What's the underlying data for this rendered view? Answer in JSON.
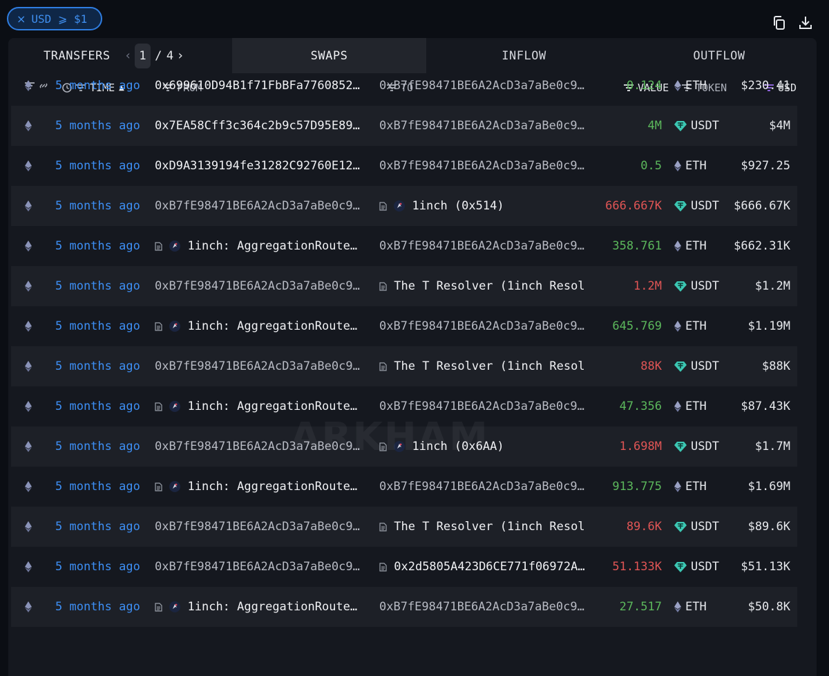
{
  "filter": {
    "close": "×",
    "label": "USD ⩾ $1"
  },
  "toolbar": {
    "copy_icon": "copy-icon",
    "download_icon": "download-icon"
  },
  "tabs": {
    "transfers": "TRANSFERS",
    "page": "1",
    "page_sep": "/",
    "page_total": "4",
    "swaps": "SWAPS",
    "inflow": "INFLOW",
    "outflow": "OUTFLOW"
  },
  "headers": {
    "time": "TIME",
    "from": "FROM",
    "to": "TO",
    "value": "VALUE",
    "token": "TOKEN",
    "usd": "USD"
  },
  "watermark": "ARKHAM",
  "rows": [
    {
      "time": "5 months ago",
      "from": "0x699610D94B1f71FbBFa7760852…",
      "from_entity": false,
      "to": "0xB7fE98471BE6A2AcD3a7aBe0c9…",
      "to_entity": false,
      "to_doc": false,
      "value": "0.124",
      "value_class": "pos",
      "token": "ETH",
      "usd": "$230.41"
    },
    {
      "time": "5 months ago",
      "from": "0x7EA58Cff3c364c2b9c57D95E89…",
      "from_entity": false,
      "to": "0xB7fE98471BE6A2AcD3a7aBe0c9…",
      "to_entity": false,
      "to_doc": false,
      "value": "4M",
      "value_class": "pos",
      "token": "USDT",
      "usd": "$4M"
    },
    {
      "time": "5 months ago",
      "from": "0xD9A3139194fe31282C92760E12…",
      "from_entity": false,
      "to": "0xB7fE98471BE6A2AcD3a7aBe0c9…",
      "to_entity": false,
      "to_doc": false,
      "value": "0.5",
      "value_class": "pos",
      "token": "ETH",
      "usd": "$927.25"
    },
    {
      "time": "5 months ago",
      "from": "0xB7fE98471BE6A2AcD3a7aBe0c9…",
      "from_entity": false,
      "to": "1inch (0x514)",
      "to_entity": true,
      "to_doc": true,
      "value": "666.667K",
      "value_class": "neg",
      "token": "USDT",
      "usd": "$666.67K"
    },
    {
      "time": "5 months ago",
      "from": "1inch: AggregationRoute…",
      "from_entity": true,
      "to": "0xB7fE98471BE6A2AcD3a7aBe0c9…",
      "to_entity": false,
      "to_doc": false,
      "value": "358.761",
      "value_class": "pos",
      "token": "ETH",
      "usd": "$662.31K"
    },
    {
      "time": "5 months ago",
      "from": "0xB7fE98471BE6A2AcD3a7aBe0c9…",
      "from_entity": false,
      "to": "The T Resolver (1inch Resol",
      "to_entity": false,
      "to_doc": true,
      "value": "1.2M",
      "value_class": "neg",
      "token": "USDT",
      "usd": "$1.2M"
    },
    {
      "time": "5 months ago",
      "from": "1inch: AggregationRoute…",
      "from_entity": true,
      "to": "0xB7fE98471BE6A2AcD3a7aBe0c9…",
      "to_entity": false,
      "to_doc": false,
      "value": "645.769",
      "value_class": "pos",
      "token": "ETH",
      "usd": "$1.19M"
    },
    {
      "time": "5 months ago",
      "from": "0xB7fE98471BE6A2AcD3a7aBe0c9…",
      "from_entity": false,
      "to": "The T Resolver (1inch Resol",
      "to_entity": false,
      "to_doc": true,
      "value": "88K",
      "value_class": "neg",
      "token": "USDT",
      "usd": "$88K"
    },
    {
      "time": "5 months ago",
      "from": "1inch: AggregationRoute…",
      "from_entity": true,
      "to": "0xB7fE98471BE6A2AcD3a7aBe0c9…",
      "to_entity": false,
      "to_doc": false,
      "value": "47.356",
      "value_class": "pos",
      "token": "ETH",
      "usd": "$87.43K"
    },
    {
      "time": "5 months ago",
      "from": "0xB7fE98471BE6A2AcD3a7aBe0c9…",
      "from_entity": false,
      "to": "1inch (0x6AA)",
      "to_entity": true,
      "to_doc": true,
      "value": "1.698M",
      "value_class": "neg",
      "token": "USDT",
      "usd": "$1.7M"
    },
    {
      "time": "5 months ago",
      "from": "1inch: AggregationRoute…",
      "from_entity": true,
      "to": "0xB7fE98471BE6A2AcD3a7aBe0c9…",
      "to_entity": false,
      "to_doc": false,
      "value": "913.775",
      "value_class": "pos",
      "token": "ETH",
      "usd": "$1.69M"
    },
    {
      "time": "5 months ago",
      "from": "0xB7fE98471BE6A2AcD3a7aBe0c9…",
      "from_entity": false,
      "to": "The T Resolver (1inch Resol",
      "to_entity": false,
      "to_doc": true,
      "value": "89.6K",
      "value_class": "neg",
      "token": "USDT",
      "usd": "$89.6K"
    },
    {
      "time": "5 months ago",
      "from": "0xB7fE98471BE6A2AcD3a7aBe0c9…",
      "from_entity": false,
      "to": "0x2d5805A423D6CE771f06972A…",
      "to_entity": false,
      "to_doc": true,
      "value": "51.133K",
      "value_class": "neg",
      "token": "USDT",
      "usd": "$51.13K"
    },
    {
      "time": "5 months ago",
      "from": "1inch: AggregationRoute…",
      "from_entity": true,
      "to": "0xB7fE98471BE6A2AcD3a7aBe0c9…",
      "to_entity": false,
      "to_doc": false,
      "value": "27.517",
      "value_class": "pos",
      "token": "ETH",
      "usd": "$50.8K"
    }
  ]
}
